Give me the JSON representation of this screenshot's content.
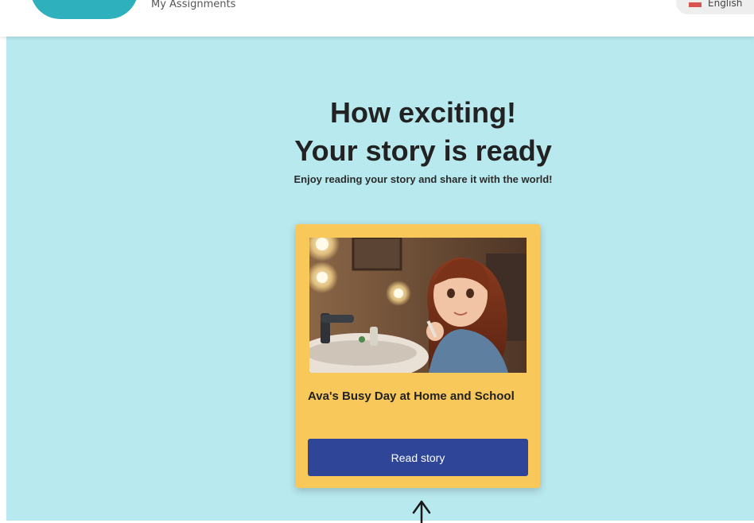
{
  "header": {
    "nav_link": "My Assignments",
    "language": "English"
  },
  "main": {
    "heading_line1": "How exciting!",
    "heading_line2": "Your story is ready",
    "subtitle": "Enjoy reading your story and share it with the world!"
  },
  "story_card": {
    "title": "Ava's Busy Day at Home and School",
    "button_label": "Read story"
  },
  "colors": {
    "page_background": "#b8e9ef",
    "card_background": "#f9c85a",
    "button_background": "#2f4597",
    "logo": "#2fb0bd"
  },
  "icons": [
    "up-arrow-icon"
  ]
}
